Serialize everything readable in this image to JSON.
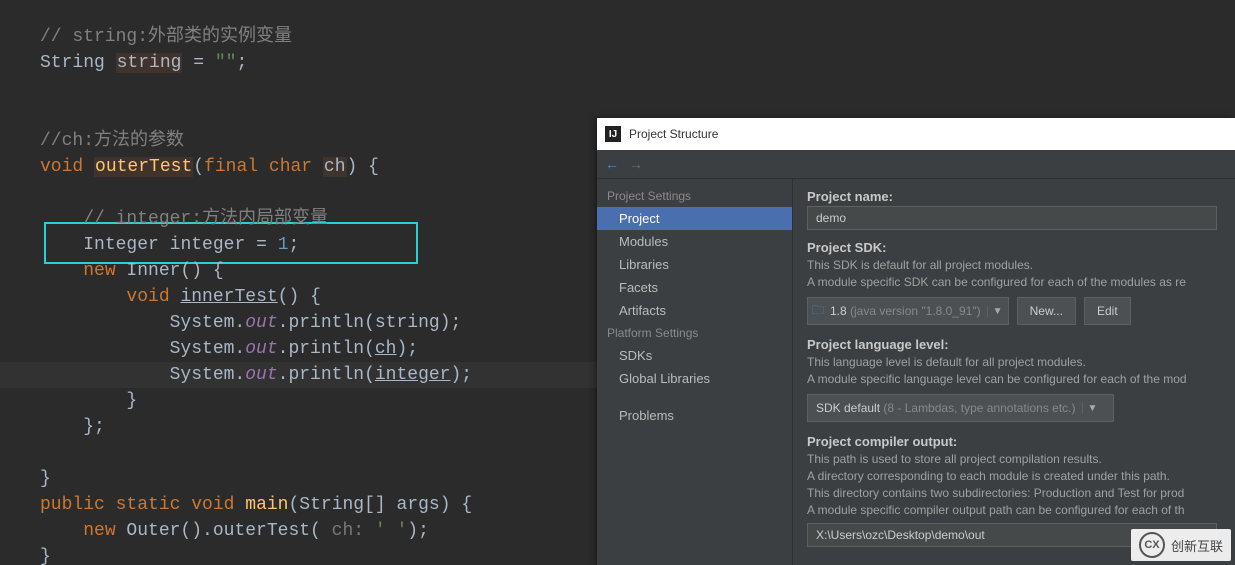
{
  "code": {
    "l1_comment": "// string:外部类的实例变量",
    "l2_type": "String",
    "l2_id": "string",
    "l2_eq": " = ",
    "l2_str": "\"\"",
    "l2_semi": ";",
    "l4_comment": "//ch:方法的参数",
    "l5_kw_void": "void",
    "l5_method": "outerTest",
    "l5_lparen": "(",
    "l5_kw_final": "final",
    "l5_kw_char": "char",
    "l5_param": "ch",
    "l5_rparen_brace": ") {",
    "l7_comment": "// integer:方法内局部变量",
    "l8_type": "Integer",
    "l8_id": "integer",
    "l8_eq": " = ",
    "l8_num": "1",
    "l8_semi": ";",
    "l9_kw_new": "new",
    "l9_name": " Inner() {",
    "l10_kw_void": "void",
    "l10_method": "innerTest",
    "l10_tail": "() {",
    "l11_sys": "System.",
    "l11_out": "out",
    "l11_print": ".println(",
    "l11_arg": "string",
    "l11_end": ");",
    "l12_sys": "System.",
    "l12_out": "out",
    "l12_print": ".println(",
    "l12_arg": "ch",
    "l12_end": ");",
    "l13_sys": "System.",
    "l13_out": "out",
    "l13_print": ".println(",
    "l13_arg": "integer",
    "l13_end": ");",
    "l14_brace": "}",
    "l15_brace_semi": "};",
    "l17_brace": "}",
    "l18_kw_public": "public",
    "l18_kw_static": "static",
    "l18_kw_void": "void",
    "l18_method": "main",
    "l18_sig": "(String[] args) {",
    "l19_kw_new": "new",
    "l19_call1": " Outer().outerTest( ",
    "l19_hint": "ch:",
    "l19_arg": " ' '",
    "l19_end": ");",
    "l20_brace": "}"
  },
  "dialog": {
    "title": "Project Structure",
    "sidebar": {
      "section1_title": "Project Settings",
      "section1_items": [
        "Project",
        "Modules",
        "Libraries",
        "Facets",
        "Artifacts"
      ],
      "section2_title": "Platform Settings",
      "section2_items": [
        "SDKs",
        "Global Libraries"
      ],
      "section3_items": [
        "Problems"
      ]
    },
    "project_name_label": "Project name:",
    "project_name_value": "demo",
    "project_sdk_label": "Project SDK:",
    "project_sdk_desc1": "This SDK is default for all project modules.",
    "project_sdk_desc2": "A module specific SDK can be configured for each of the modules as re",
    "sdk_combo_main": "1.8",
    "sdk_combo_dim": " (java version \"1.8.0_91\")",
    "btn_new": "New...",
    "btn_edit": "Edit",
    "lang_level_label": "Project language level:",
    "lang_level_desc1": "This language level is default for all project modules.",
    "lang_level_desc2": "A module specific language level can be configured for each of the mod",
    "lang_combo_main": "SDK default",
    "lang_combo_dim": " (8 - Lambdas, type annotations etc.)",
    "compiler_label": "Project compiler output:",
    "compiler_desc1": "This path is used to store all project compilation results.",
    "compiler_desc2": "A directory corresponding to each module is created under this path.",
    "compiler_desc3": "This directory contains two subdirectories: Production and Test for prod",
    "compiler_desc4": "A module specific compiler output path can be configured for each of th",
    "compiler_path": "X:\\Users\\ozc\\Desktop\\demo\\out"
  },
  "watermark": {
    "icon_text": "CX",
    "text": "创新互联"
  }
}
